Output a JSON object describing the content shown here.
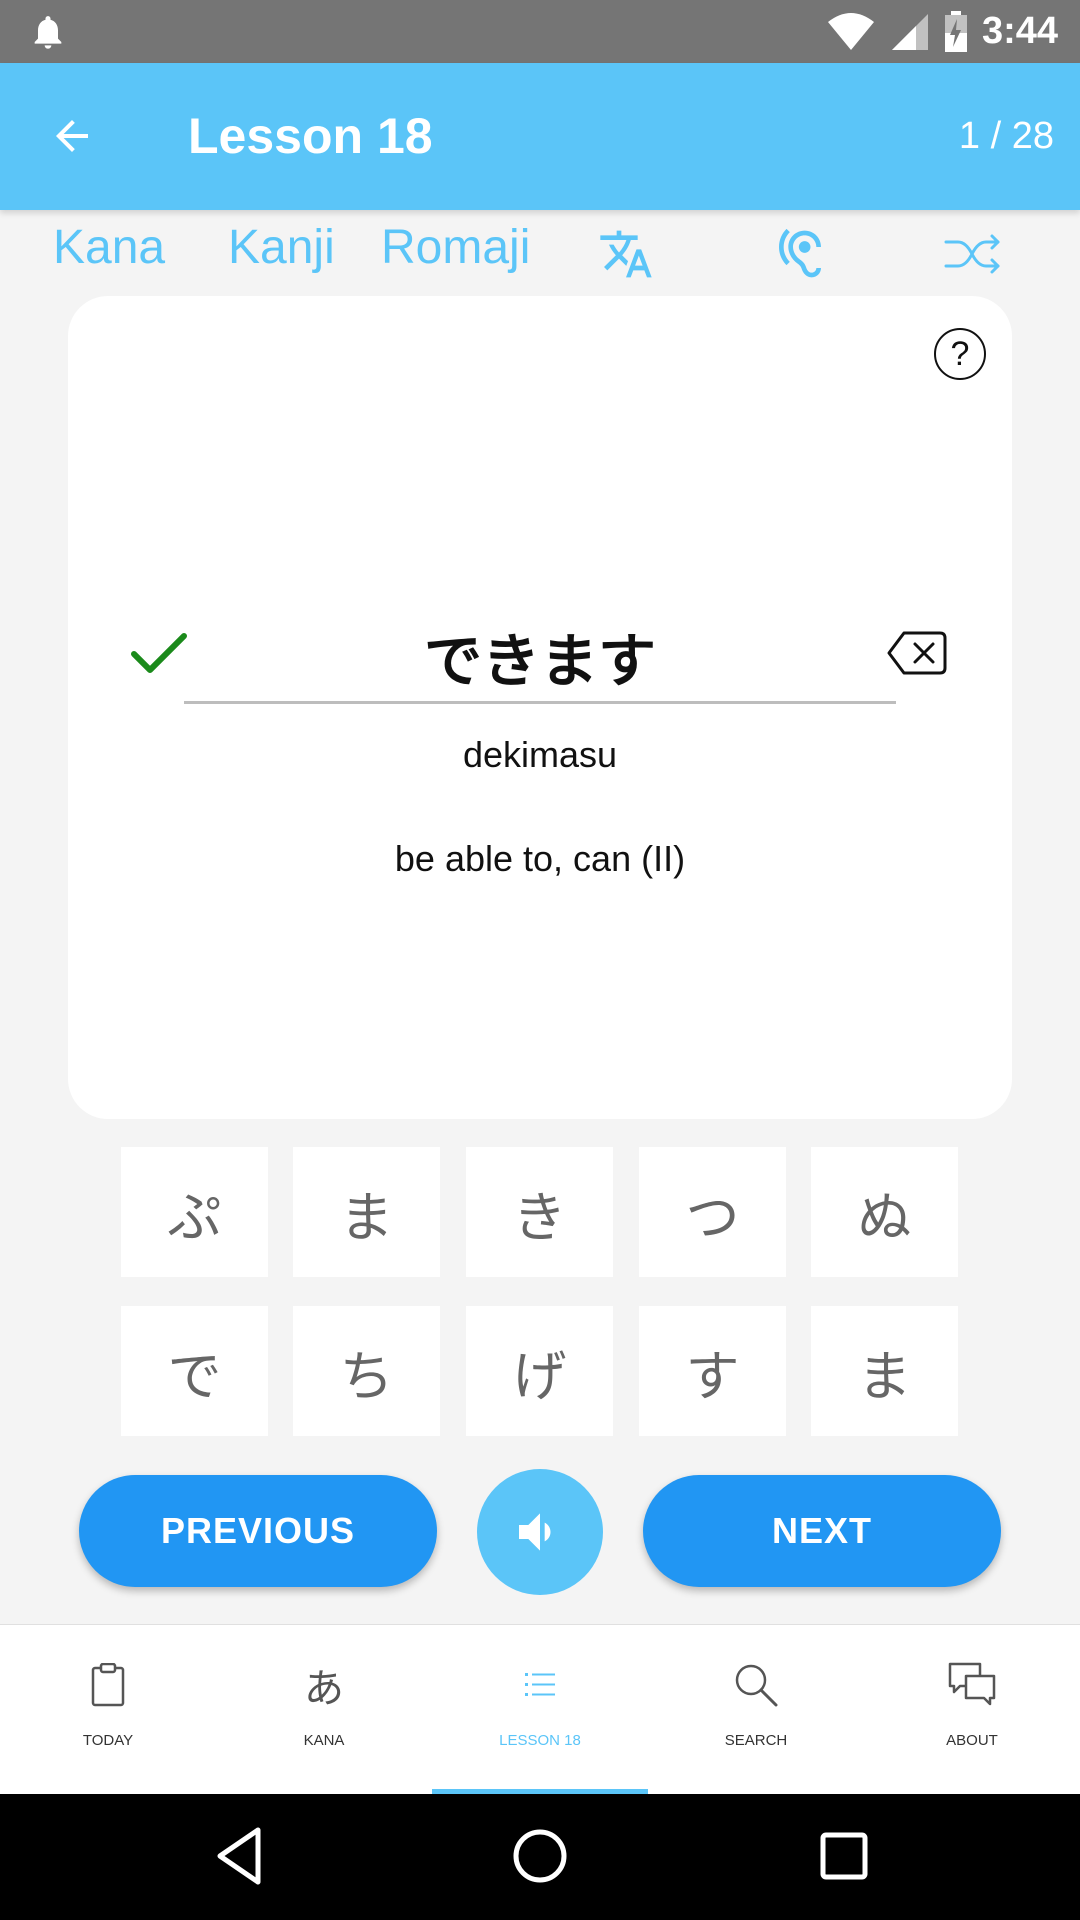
{
  "status_bar": {
    "time": "3:44"
  },
  "app_bar": {
    "title": "Lesson 18",
    "counter": "1 / 28"
  },
  "modes": {
    "kana": "Kana",
    "kanji": "Kanji",
    "romaji": "Romaji"
  },
  "card": {
    "help": "?",
    "answer": "できます",
    "romaji": "dekimasu",
    "meaning": "be able to, can (II)"
  },
  "keys": [
    [
      "ぷ",
      "ま",
      "き",
      "つ",
      "ぬ"
    ],
    [
      "で",
      "ち",
      "げ",
      "す",
      "ま"
    ]
  ],
  "buttons": {
    "previous": "PREVIOUS",
    "next": "NEXT"
  },
  "nav": {
    "today": "TODAY",
    "kana": "KANA",
    "kana_glyph": "あ",
    "lesson": "LESSON 18",
    "search": "SEARCH",
    "about": "ABOUT",
    "active": "lesson"
  },
  "colors": {
    "accent": "#5bc5f8",
    "button": "#2196f3",
    "check": "#1b8a1b"
  }
}
